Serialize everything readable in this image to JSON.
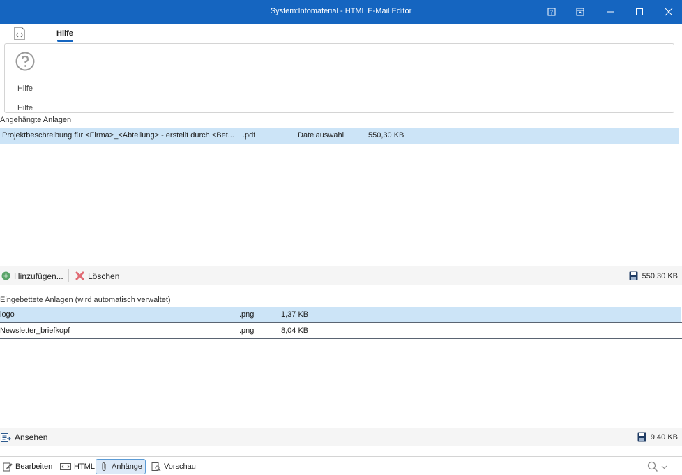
{
  "window": {
    "title": "System:Infomaterial - HTML E-Mail Editor",
    "controls": [
      "help-icon",
      "restore-layout-icon",
      "minimize-icon",
      "maximize-icon",
      "close-icon"
    ]
  },
  "ribbon": {
    "tab_label": "Hilfe",
    "help_button_label": "Hilfe",
    "group_label": "Hilfe"
  },
  "attached": {
    "section_label": "Angehängte Anlagen",
    "rows": [
      {
        "name": "Projektbeschreibung für <Firma>_<Abteilung> - erstellt durch <Bet...",
        "ext": ".pdf",
        "source": "Dateiauswahl",
        "size": "550,30 KB"
      }
    ],
    "toolbar": {
      "add_label": "Hinzufügen...",
      "delete_label": "Löschen",
      "total_size": "550,30 KB"
    }
  },
  "embedded": {
    "section_label": "Eingebettete Anlagen (wird automatisch verwaltet)",
    "rows": [
      {
        "name": "logo",
        "ext": ".png",
        "size": "1,37 KB"
      },
      {
        "name": "Newsletter_briefkopf",
        "ext": ".png",
        "size": "8,04 KB"
      }
    ],
    "toolbar": {
      "view_label": "Ansehen",
      "total_size": "9,40 KB"
    }
  },
  "bottom_tabs": {
    "edit_label": "Bearbeiten",
    "html_label": "HTML",
    "attachments_label": "Anhänge",
    "preview_label": "Vorschau"
  },
  "colors": {
    "accent": "#1565c0",
    "selection": "#cce4f7"
  }
}
